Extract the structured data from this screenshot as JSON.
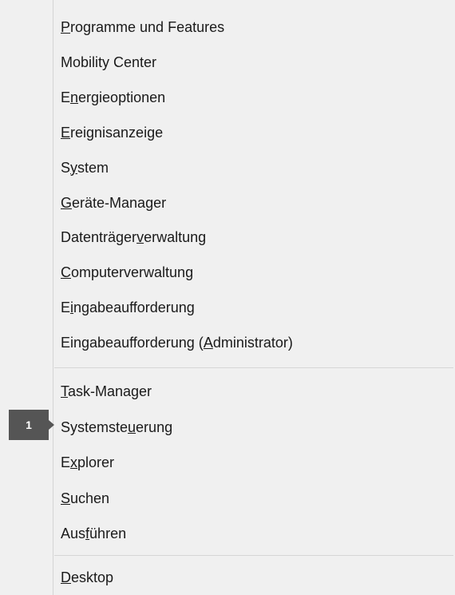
{
  "menu": {
    "group1": [
      {
        "name": "menu-item-programme-und-features",
        "pre": "",
        "ul": "P",
        "post": "rogramme und Features"
      },
      {
        "name": "menu-item-mobility-center",
        "pre": "Mobility Center",
        "ul": "",
        "post": ""
      },
      {
        "name": "menu-item-energieoptionen",
        "pre": "E",
        "ul": "n",
        "post": "ergieoptionen"
      },
      {
        "name": "menu-item-ereignisanzeige",
        "pre": "",
        "ul": "E",
        "post": "reignisanzeige"
      },
      {
        "name": "menu-item-system",
        "pre": "S",
        "ul": "y",
        "post": "stem"
      },
      {
        "name": "menu-item-geraete-manager",
        "pre": "",
        "ul": "G",
        "post": "eräte-Manager"
      },
      {
        "name": "menu-item-datentraegerverwaltung",
        "pre": "Datenträger",
        "ul": "v",
        "post": "erwaltung"
      },
      {
        "name": "menu-item-computerverwaltung",
        "pre": "",
        "ul": "C",
        "post": "omputerverwaltung"
      },
      {
        "name": "menu-item-eingabeaufforderung",
        "pre": "E",
        "ul": "i",
        "post": "ngabeaufforderung"
      },
      {
        "name": "menu-item-eingabeaufforderung-admin",
        "pre": "Eingabeaufforderung (",
        "ul": "A",
        "post": "dministrator)"
      }
    ],
    "group2": [
      {
        "name": "menu-item-task-manager",
        "pre": "",
        "ul": "T",
        "post": "ask-Manager"
      },
      {
        "name": "menu-item-systemsteuerung",
        "pre": "Systemste",
        "ul": "u",
        "post": "erung"
      },
      {
        "name": "menu-item-explorer",
        "pre": "E",
        "ul": "x",
        "post": "plorer"
      },
      {
        "name": "menu-item-suchen",
        "pre": "",
        "ul": "S",
        "post": "uchen"
      },
      {
        "name": "menu-item-ausfuehren",
        "pre": "Aus",
        "ul": "f",
        "post": "ühren"
      }
    ],
    "group3": [
      {
        "name": "menu-item-desktop",
        "pre": "",
        "ul": "D",
        "post": "esktop"
      }
    ]
  },
  "badge": {
    "label": "1"
  },
  "colors": {
    "background": "#f0f0f0",
    "badge": "#555555",
    "divider": "#d6d6d6"
  }
}
